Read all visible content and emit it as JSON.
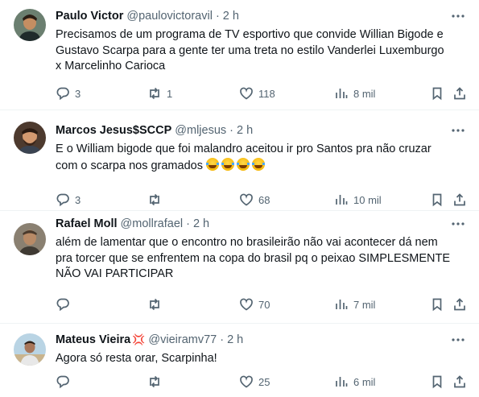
{
  "tweets": [
    {
      "name": "Paulo Victor",
      "handle": "@paulovictoravil",
      "time": "2 h",
      "text": "Precisamos de um programa de TV esportivo que convide Willian Bigode e\nGustavo Scarpa para a gente ter uma treta no estilo Vanderlei Luxemburgo\nx Marcelinho Carioca",
      "replies": "3",
      "retweets": "1",
      "likes": "118",
      "views": "8 mil"
    },
    {
      "name": "Marcos Jesus$SCCP",
      "handle": "@mljesus",
      "time": "2 h",
      "text": "E o William bigode que foi malandro aceitou ir pro Santos pra não cruzar\ncom o scarpa nos gramados ",
      "emoji_count": 4,
      "emoji_name": "face-with-tears-of-joy-emoji",
      "replies": "3",
      "retweets": "",
      "likes": "68",
      "views": "10 mil"
    },
    {
      "name": "Rafael Moll",
      "handle": "@mollrafael",
      "time": "2 h",
      "text": "além de lamentar que o encontro no brasileirão não vai acontecer dá nem\npra torcer que se enfrentem na copa do brasil pq o peixao SIMPLESMENTE\nNÃO VAI PARTICIPAR",
      "replies": "",
      "retweets": "",
      "likes": "70",
      "views": "7 mil"
    },
    {
      "name": "Mateus Vieira",
      "name_emoji": "anger-symbol-emoji",
      "handle": "@vieiramv77",
      "time": "2 h",
      "text": "Agora só resta orar, Scarpinha!",
      "replies": "",
      "retweets": "",
      "likes": "25",
      "views": "6 mil"
    }
  ],
  "ui": {
    "separator": "·",
    "more": "···"
  },
  "colors": {
    "text": "#0f1419",
    "muted": "#536471",
    "divider": "#eff3f4"
  }
}
